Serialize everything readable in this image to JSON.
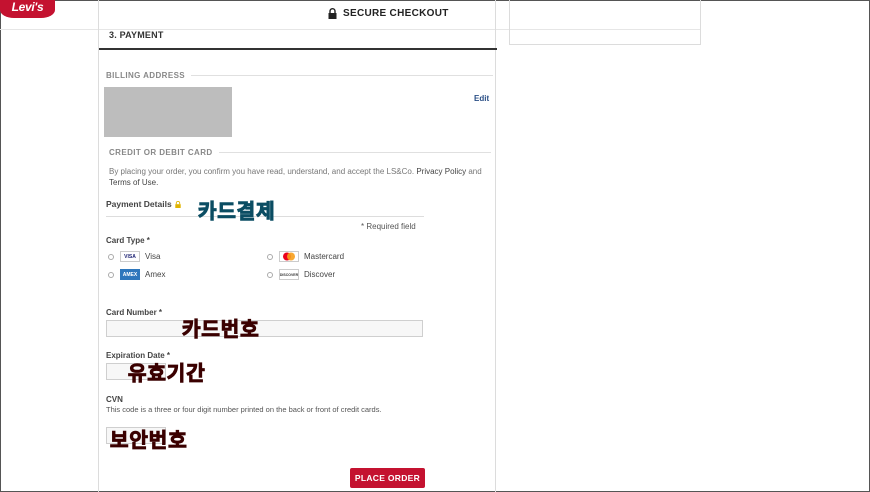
{
  "header": {
    "logo_text": "Levi's",
    "secure_label": "SECURE CHECKOUT"
  },
  "payment": {
    "step_title": "3. PAYMENT",
    "billing_heading": "BILLING ADDRESS",
    "edit_label": "Edit",
    "card_heading": "CREDIT OR DEBIT CARD",
    "disclaimer_prefix": "By placing your order, you confirm you have read, understand, and accept the LS&Co.",
    "privacy_link": "Privacy Policy",
    "and_text": "and",
    "terms_link": "Terms of Use.",
    "details_label": "Payment Details",
    "required_note": "* Required field",
    "card_type_label": "Card Type *",
    "card_types": {
      "visa": "Visa",
      "mastercard": "Mastercard",
      "amex": "Amex",
      "discover": "Discover"
    },
    "card_logo_text": {
      "visa": "VISA",
      "amex": "AMEX",
      "discover": "DISCOVER"
    },
    "card_number_label": "Card Number *",
    "expiration_label": "Expiration Date *",
    "cvn_label": "CVN",
    "cvn_description": "This code is a three or four digit number printed on the back or front of credit cards.",
    "place_order_label": "PLACE ORDER"
  },
  "annotations": {
    "card_payment": "카드결제",
    "card_number": "카드번호",
    "expiry": "유효기간",
    "security_code": "보안번호"
  },
  "colors": {
    "brand_red": "#c41230",
    "link_blue": "#2a4f86",
    "annot_teal": "#1fb8d6",
    "annot_red": "#d61616"
  }
}
